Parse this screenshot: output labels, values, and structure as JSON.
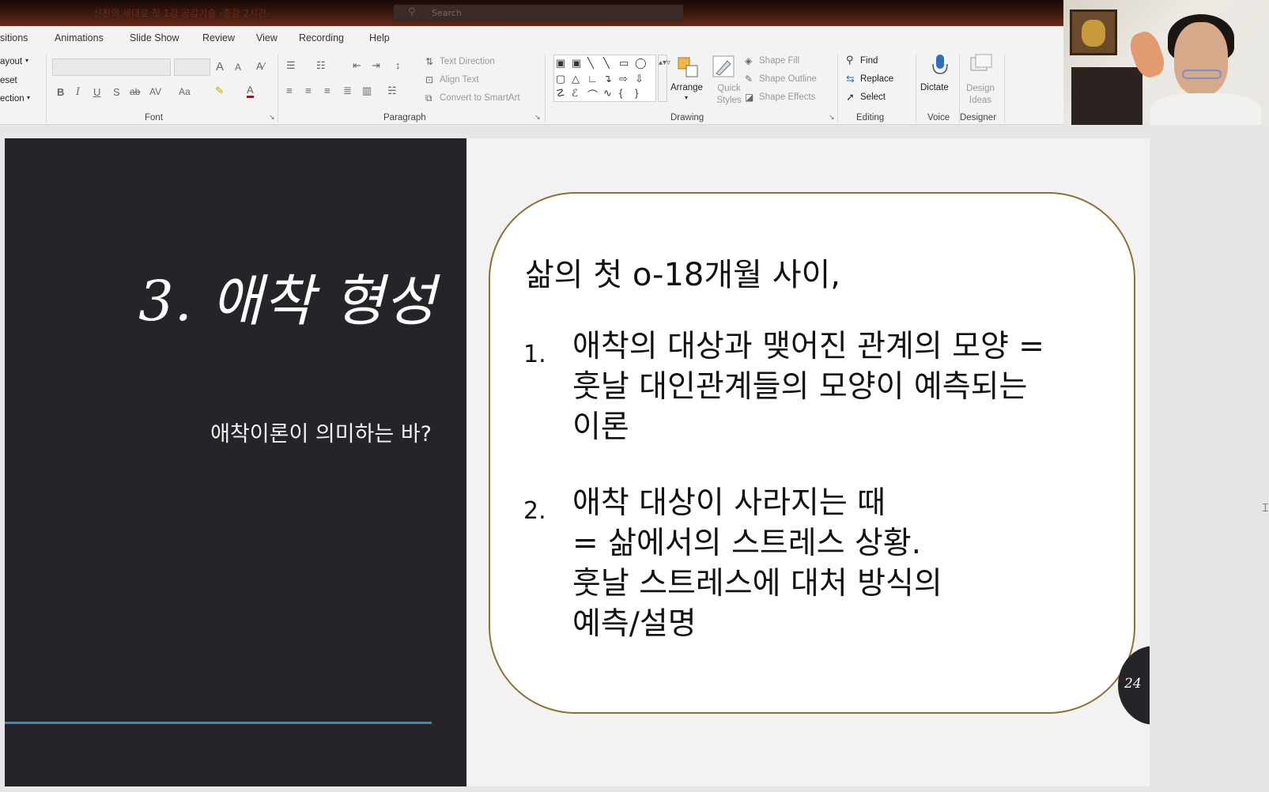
{
  "window": {
    "doc_title": "신천의 세대로 첫 1강 공감기술 -총강 2시간-",
    "search_placeholder": "Search"
  },
  "menu_tabs": [
    "sitions",
    "Animations",
    "Slide Show",
    "Review",
    "View",
    "Recording",
    "Help"
  ],
  "ribbon": {
    "slides_group": {
      "layout": "ayout",
      "reset": "eset",
      "section": "ection"
    },
    "font_group": {
      "label": "Font",
      "bold": "B",
      "italic": "I",
      "underline": "U",
      "shadow": "S",
      "strike": "ab",
      "spacing": "AV",
      "case": "Aa",
      "grow": "A",
      "shrink": "A"
    },
    "paragraph_group": {
      "label": "Paragraph",
      "text_direction": "Text Direction",
      "align_text": "Align Text",
      "convert_smartart": "Convert to SmartArt"
    },
    "drawing_group": {
      "label": "Drawing",
      "arrange": "Arrange",
      "quick_styles": "Quick Styles",
      "shape_fill": "Shape Fill",
      "shape_outline": "Shape Outline",
      "shape_effects": "Shape Effects"
    },
    "editing_group": {
      "label": "Editing",
      "find": "Find",
      "replace": "Replace",
      "select": "Select"
    },
    "voice_group": {
      "label": "Voice",
      "dictate": "Dictate"
    },
    "designer_group": {
      "label": "Designer",
      "design_ideas": "Design Ideas"
    }
  },
  "slide": {
    "title": "3. 애착 형성",
    "subtitle": "애착이론이 의미하는 바?",
    "intro": "삶의 첫 o-18개월 사이,",
    "items": [
      {
        "num": "1.",
        "text": "애착의 대상과 맺어진 관계의 모양 =\n훗날 대인관계들의 모양이 예측되는\n이론"
      },
      {
        "num": "2.",
        "text": "애착 대상이 사라지는 때\n= 삶에서의 스트레스 상황.\n훗날 스트레스에 대처 방식의\n예측/설명"
      }
    ],
    "page_number": "24",
    "colors": {
      "left_panel": "#262428",
      "accent_line": "#2f8fc0",
      "card_border": "#8a7330"
    }
  }
}
